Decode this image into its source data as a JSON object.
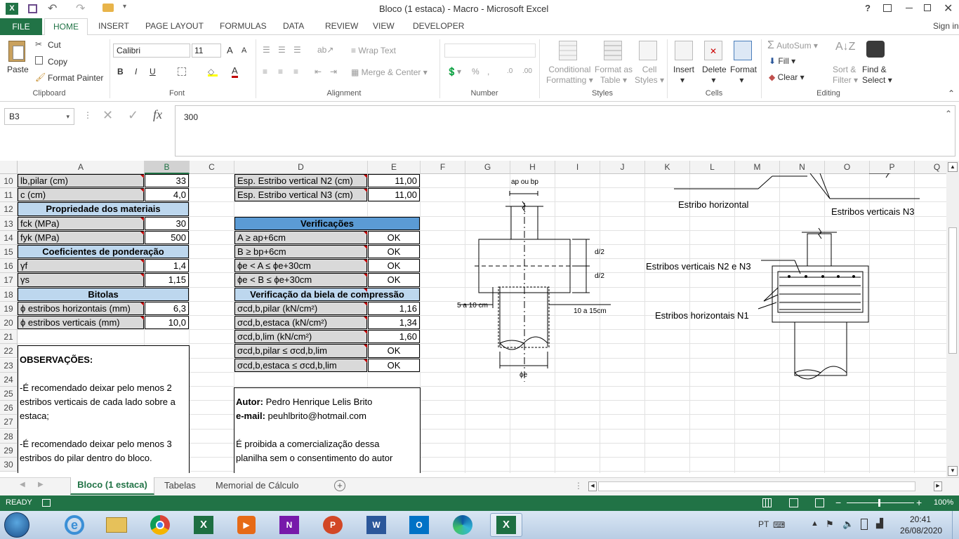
{
  "window": {
    "title": "Bloco (1 estaca) - Macro - Microsoft Excel",
    "help": "?",
    "signin": "Sign in"
  },
  "ribbon_tabs": [
    "FILE",
    "HOME",
    "INSERT",
    "PAGE LAYOUT",
    "FORMULAS",
    "DATA",
    "REVIEW",
    "VIEW",
    "DEVELOPER"
  ],
  "ribbon": {
    "clipboard": {
      "paste": "Paste",
      "cut": "Cut",
      "copy": "Copy",
      "format_painter": "Format Painter",
      "label": "Clipboard"
    },
    "font": {
      "name": "Calibri",
      "size": "11",
      "label": "Font",
      "bold": "B",
      "italic": "I",
      "underline": "U",
      "grow": "A",
      "shrink": "A"
    },
    "alignment": {
      "wrap": "Wrap Text",
      "merge": "Merge & Center",
      "label": "Alignment"
    },
    "number": {
      "percent": "%",
      "label": "Number"
    },
    "styles": {
      "conditional": "Conditional",
      "conditional2": "Formatting",
      "format_as": "Format as",
      "format_as2": "Table",
      "cell": "Cell",
      "cell2": "Styles",
      "label": "Styles"
    },
    "cells": {
      "insert": "Insert",
      "delete": "Delete",
      "format": "Format",
      "label": "Cells"
    },
    "editing": {
      "autosum": "AutoSum",
      "fill": "Fill",
      "clear": "Clear",
      "sort": "Sort &",
      "sort2": "Filter",
      "find": "Find &",
      "find2": "Select",
      "label": "Editing"
    }
  },
  "formula_bar": {
    "name_box": "B3",
    "fx": "fx",
    "value": "300"
  },
  "columns": [
    "A",
    "B",
    "C",
    "D",
    "E",
    "F",
    "G",
    "H",
    "I",
    "J",
    "K",
    "L",
    "M",
    "N",
    "O",
    "P",
    "Q"
  ],
  "rows": [
    "10",
    "11",
    "12",
    "13",
    "14",
    "15",
    "16",
    "17",
    "18",
    "19",
    "20",
    "21",
    "22",
    "23",
    "24",
    "25",
    "26",
    "27",
    "28",
    "29",
    "30"
  ],
  "cells": {
    "A10": "lb,pilar (cm)",
    "B10": "33",
    "A11": "c (cm)",
    "B11": "4,0",
    "A12": "Propriedade dos materiais",
    "A13": "fck (MPa)",
    "B13": "30",
    "A14": "fyk (MPa)",
    "B14": "500",
    "A15": "Coeficientes de ponderação",
    "A16": "γf",
    "B16": "1,4",
    "A17": "γs",
    "B17": "1,15",
    "A18": "Bitolas",
    "A19": "ϕ estribos horizontais (mm)",
    "B19": "6,3",
    "A20": "ϕ estribos verticais (mm)",
    "B20": "10,0",
    "D10": "Esp. Estribo vertical N2 (cm)",
    "E10": "11,00",
    "D11": "Esp. Estribo vertical N3 (cm)",
    "E11": "11,00",
    "D13": "Verificações",
    "D14": "A ≥ ap+6cm",
    "E14": "OK",
    "D15": "B ≥ bp+6cm",
    "E15": "OK",
    "D16": "ϕe < A ≤ ϕe+30cm",
    "E16": "OK",
    "D17": "ϕe < B ≤ ϕe+30cm",
    "E17": "OK",
    "D18": "Verificação da biela de compressão",
    "D19": "σcd,b,pilar (kN/cm²)",
    "E19": "1,16",
    "D20": "σcd,b,estaca (kN/cm²)",
    "E20": "1,34",
    "D21": "σcd,b,lim (kN/cm²)",
    "E21": "1,60",
    "D22": "σcd,b,pilar ≤ σcd,b,lim",
    "E22": "OK",
    "D23": "σcd,b,estaca ≤ σcd,b,lim",
    "E23": "OK"
  },
  "observations": {
    "title": "OBSERVAÇÕES:",
    "line1": "-É recomendado deixar pelo menos 2",
    "line2": "estribos verticais de cada lado sobre a",
    "line3": "estaca;",
    "line4": "-É recomendado deixar pelo menos 3",
    "line5": "estribos do pilar dentro do bloco."
  },
  "author": {
    "label": "Autor:",
    "name": "Pedro Henrique Lelis Brito",
    "email_label": "e-mail:",
    "email": "peuhlbrito@hotmail.com",
    "notice1": "É proibida a comercialização dessa",
    "notice2": "planilha sem o consentimento do autor"
  },
  "drawing1": {
    "top": "ap ou bp",
    "d2a": "d/2",
    "d2b": "d/2",
    "left": "5 a 10 cm",
    "right": "10 a 15cm",
    "bottom": "ϕe"
  },
  "drawing2": {
    "h": "Estribo horizontal",
    "v3": "Estribos verticais N3",
    "v23": "Estribos verticais N2 e N3",
    "h1": "Estribos horizontais N1"
  },
  "sheets": [
    "Bloco (1 estaca)",
    "Tabelas",
    "Memorial de Cálculo"
  ],
  "status": {
    "ready": "READY",
    "zoom": "100%"
  },
  "taskbar": {
    "lang": "PT",
    "time": "20:41",
    "date": "26/08/2020"
  }
}
